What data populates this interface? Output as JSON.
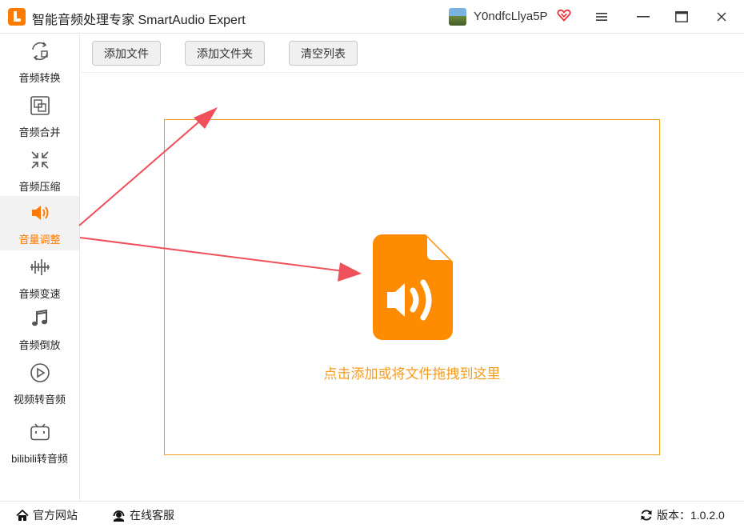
{
  "window": {
    "title": "智能音频处理专家 SmartAudio Expert",
    "username": "Y0ndfcLlya5P"
  },
  "sidebar": {
    "items": [
      {
        "label": "音频转换",
        "icon": "convert-icon"
      },
      {
        "label": "音频合并",
        "icon": "merge-icon"
      },
      {
        "label": "音频压缩",
        "icon": "compress-icon"
      },
      {
        "label": "音量调整",
        "icon": "volume-icon",
        "active": true
      },
      {
        "label": "音频变速",
        "icon": "speed-icon"
      },
      {
        "label": "音频倒放",
        "icon": "music-note-icon"
      },
      {
        "label": "视频转音频",
        "icon": "play-icon"
      },
      {
        "label": "bilibili转音频",
        "icon": "bilibili-icon"
      }
    ]
  },
  "toolbar": {
    "add_file": "添加文件",
    "add_folder": "添加文件夹",
    "clear_list": "清空列表"
  },
  "main": {
    "drop_hint": "点击添加或将文件拖拽到这里"
  },
  "statusbar": {
    "official_site": "官方网站",
    "online_service": "在线客服",
    "version": "版本：1.0.2.0"
  },
  "colors": {
    "accent": "#ff7a00",
    "drop_border": "#f0a020",
    "drop_text": "#f59b1f",
    "annotation_arrow": "#f0505a"
  }
}
